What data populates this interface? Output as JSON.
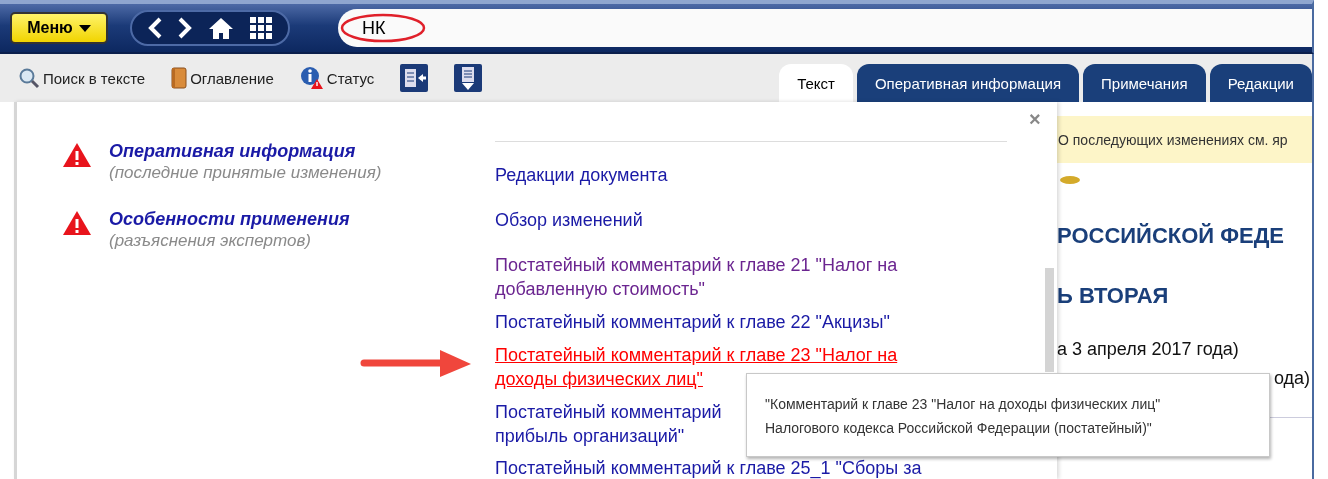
{
  "menu_button": {
    "label": "Меню"
  },
  "search": {
    "value": "НК",
    "highlighted": true
  },
  "toolbar": [
    {
      "kind": "search",
      "label": "Поиск в тексте"
    },
    {
      "kind": "book",
      "label": "Оглавление"
    },
    {
      "kind": "status",
      "label": "Статус"
    },
    {
      "kind": "doc-left"
    },
    {
      "kind": "doc-down"
    }
  ],
  "tabs": [
    {
      "label": "Текст",
      "selected": true
    },
    {
      "label": "Оперативная информация",
      "selected": false
    },
    {
      "label": "Примечания",
      "selected": false
    },
    {
      "label": "Редакции",
      "selected": false
    }
  ],
  "status_panel": {
    "close": "×",
    "notices": [
      {
        "title": "Оперативная информация",
        "subtitle": "(последние принятые изменения)"
      },
      {
        "title": "Особенности применения",
        "subtitle": "(разъяснения экспертов)"
      }
    ],
    "links": [
      {
        "lines": [
          "Редакции документа"
        ],
        "visited": false,
        "hovered": false
      },
      {
        "lines": [
          "Обзор изменений"
        ],
        "visited": false,
        "hovered": false
      },
      {
        "lines": [
          "Постатейный комментарий к главе 21 \"Налог на",
          "добавленную стоимость\""
        ],
        "visited": true,
        "hovered": false
      },
      {
        "lines": [
          "Постатейный комментарий к главе 22 \"Акцизы\""
        ],
        "visited": false,
        "hovered": false
      },
      {
        "lines": [
          "Постатейный комментарий к главе 23 \"Налог на",
          "доходы физических лиц\""
        ],
        "visited": false,
        "hovered": true
      },
      {
        "lines": [
          "Постатейный комментарий",
          "прибыль организаций\""
        ],
        "visited": false,
        "hovered": false
      },
      {
        "lines": [
          "Постатейный комментарий к главе 25_1 \"Сборы за"
        ],
        "visited": false,
        "hovered": false
      }
    ]
  },
  "tooltip": {
    "lines": [
      "\"Комментарий к главе 23 \"Налог на доходы физических лиц\"",
      "Налогового кодекса Российской Федерации (постатейный)\""
    ]
  },
  "document": {
    "banner": "О последующих изменениях см. яр",
    "headings": [
      "РОССИЙСКОЙ ФЕДЕ",
      "Ь ВТОРАЯ"
    ],
    "lines": [
      "а 3 апреля 2017 года)",
      "ода)"
    ]
  }
}
